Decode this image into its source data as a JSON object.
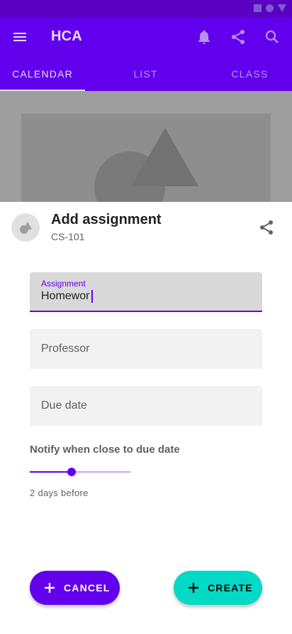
{
  "colors": {
    "primary": "#6200ee",
    "secondary": "#03dac5"
  },
  "app_bar": {
    "title": "HCA",
    "actions": [
      {
        "icon": "bell-icon"
      },
      {
        "icon": "share-icon"
      },
      {
        "icon": "search-icon"
      }
    ]
  },
  "tabs": [
    {
      "label": "CALENDAR",
      "selected": true
    },
    {
      "label": "LIST",
      "selected": false
    },
    {
      "label": "CLASS",
      "selected": false
    }
  ],
  "sheet": {
    "title": "Add assignment",
    "subtitle": "CS-101",
    "fields": {
      "assignment": {
        "label": "Assignment",
        "value": "Homewor"
      },
      "professor": {
        "placeholder": "Professor"
      },
      "due_date": {
        "placeholder": "Due date"
      }
    },
    "notify": {
      "label": "Notify when close to due date",
      "value_text": "2 days before"
    },
    "buttons": {
      "cancel": "CANCEL",
      "create": "CREATE"
    }
  }
}
